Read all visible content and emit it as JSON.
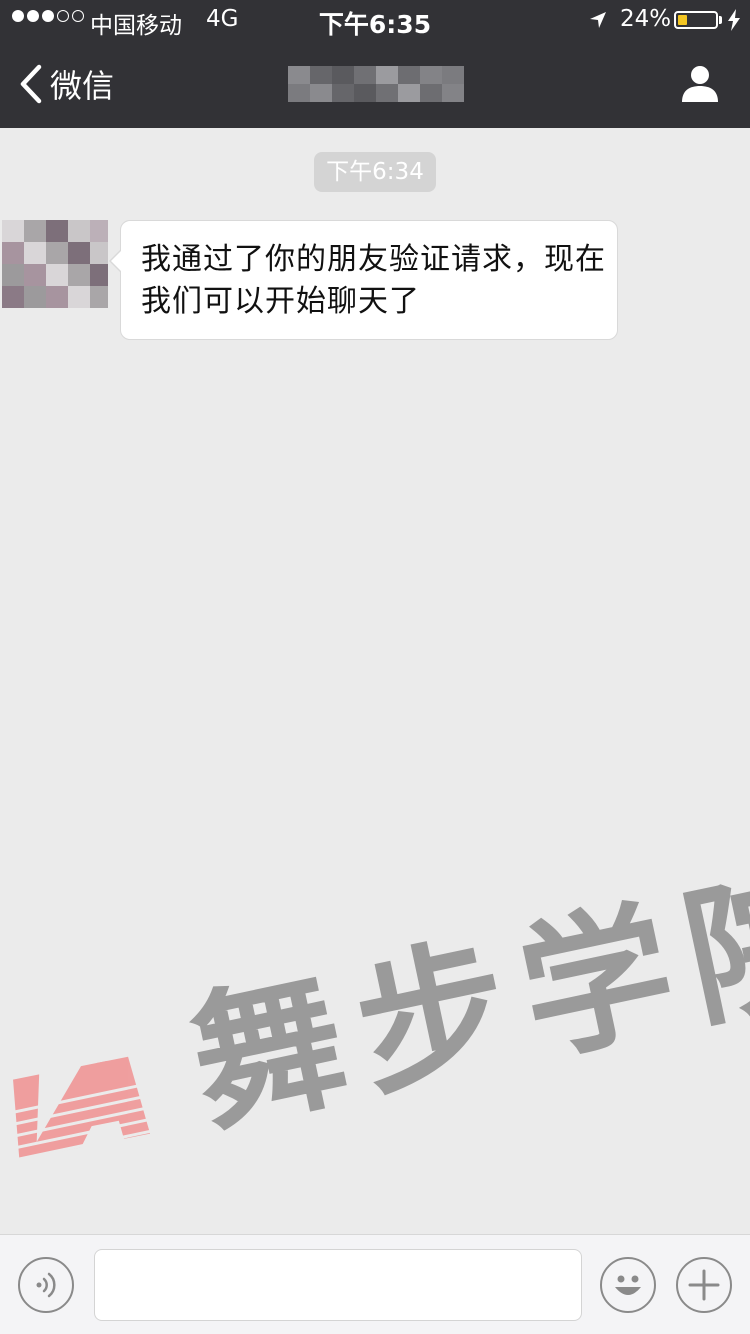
{
  "status_bar": {
    "carrier": "中国移动",
    "network": "4G",
    "time": "下午6:35",
    "battery_text": "24%",
    "battery_level": 0.24,
    "signal_strength": 3,
    "signal_max": 5,
    "icons": [
      "location-arrow-icon",
      "battery-icon",
      "charging-bolt-icon"
    ]
  },
  "nav": {
    "back_label": "微信",
    "title_pixelated": true,
    "profile_icon": "person-icon"
  },
  "chat": {
    "timestamp": "下午6:34",
    "messages": [
      {
        "sender": "contact",
        "avatar_pixelated": true,
        "text": "我通过了你的朋友验证请求，现在我们可以开始聊天了"
      }
    ]
  },
  "watermark": {
    "text": "舞步学院",
    "logo_color": "#f08c8c",
    "text_color": "#9a9a9a"
  },
  "input_bar": {
    "value": "",
    "placeholder": "",
    "icons": [
      "voice-icon",
      "emoji-icon",
      "plus-icon"
    ]
  },
  "colors": {
    "header_bg": "#323236",
    "chat_bg": "#ebebeb",
    "battery_fill": "#f3c623",
    "bubble_bg": "#ffffff"
  }
}
